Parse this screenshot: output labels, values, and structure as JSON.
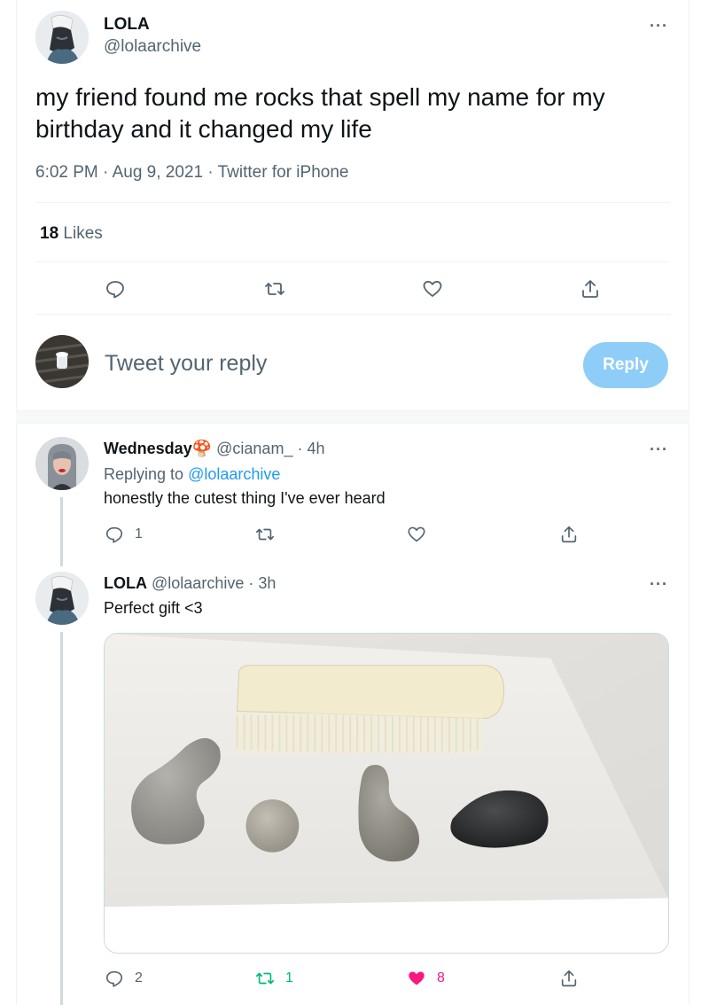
{
  "main_tweet": {
    "author_name": "LOLA",
    "author_handle": "@lolaarchive",
    "text": "my friend found me rocks that spell my name for my birthday and it changed my life",
    "meta": "6:02 PM · Aug 9, 2021 · Twitter for iPhone",
    "likes_count": "18",
    "likes_label": "Likes",
    "more": "···"
  },
  "composer": {
    "placeholder": "Tweet your reply",
    "reply_button": "Reply"
  },
  "replies": [
    {
      "author_name": "Wednesday🍄",
      "author_handle": "@cianam_",
      "time": "· 4h",
      "replying_to_label": "Replying to",
      "replying_to_handle": "@lolaarchive",
      "text": "honestly the cutest thing I've ever heard",
      "reply_count": "1",
      "retweet_count": "",
      "like_count": "",
      "more": "···"
    },
    {
      "author_name": "LOLA",
      "author_handle": "@lolaarchive",
      "time": "· 3h",
      "text": "Perfect gift <3",
      "reply_count": "2",
      "retweet_count": "1",
      "like_count": "8",
      "liked": true,
      "retweeted": true,
      "more": "···"
    }
  ],
  "icons": {
    "reply": "reply-icon",
    "retweet": "retweet-icon",
    "like": "heart-icon",
    "share": "share-icon"
  },
  "colors": {
    "accent": "#1d9bf0",
    "retweet_green": "#00ba7c",
    "like_pink": "#f91880",
    "reply_button": "#8ecdf7"
  }
}
